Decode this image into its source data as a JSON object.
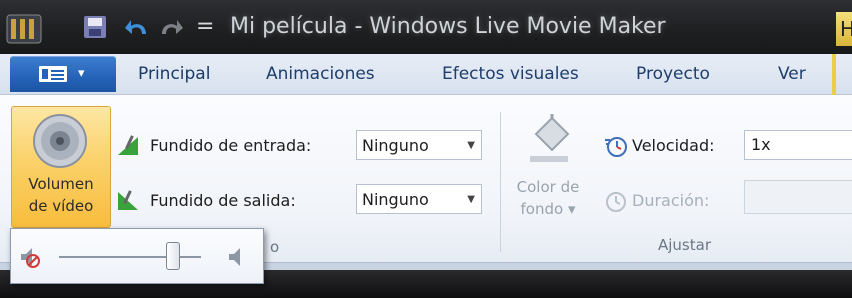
{
  "window": {
    "title": "Mi película - Windows Live Movie Maker",
    "title_tail": "H",
    "qat_more": "="
  },
  "tabs": {
    "file_caret": "▾",
    "items": [
      {
        "label": "Principal"
      },
      {
        "label": "Animaciones"
      },
      {
        "label": "Efectos visuales"
      },
      {
        "label": "Proyecto"
      },
      {
        "label": "Ver"
      }
    ]
  },
  "ribbon": {
    "volume_button": "Volumen\nde vídeo",
    "fade_in_label": "Fundido de entrada:",
    "fade_in_value": "Ninguno",
    "fade_out_label": "Fundido de salida:",
    "fade_out_value": "Ninguno",
    "background_color_label": "Color de\nfondo ▾",
    "speed_label": "Velocidad:",
    "speed_value": "1x",
    "duration_label": "Duración:",
    "duration_value": "",
    "group_label": "Ajustar",
    "partial_group_label": "o"
  },
  "volume_flyout": {
    "level_fraction": 0.8
  },
  "colors": {
    "accent_orange": "#f7bd3d",
    "file_tab_blue": "#2563b8"
  },
  "icons": [
    "app-icon",
    "save-icon",
    "undo-icon",
    "redo-icon",
    "speaker-icon",
    "fade-in-icon",
    "fade-out-icon",
    "paint-bucket-icon",
    "speed-icon",
    "duration-icon",
    "mute-icon",
    "volume-icon"
  ]
}
